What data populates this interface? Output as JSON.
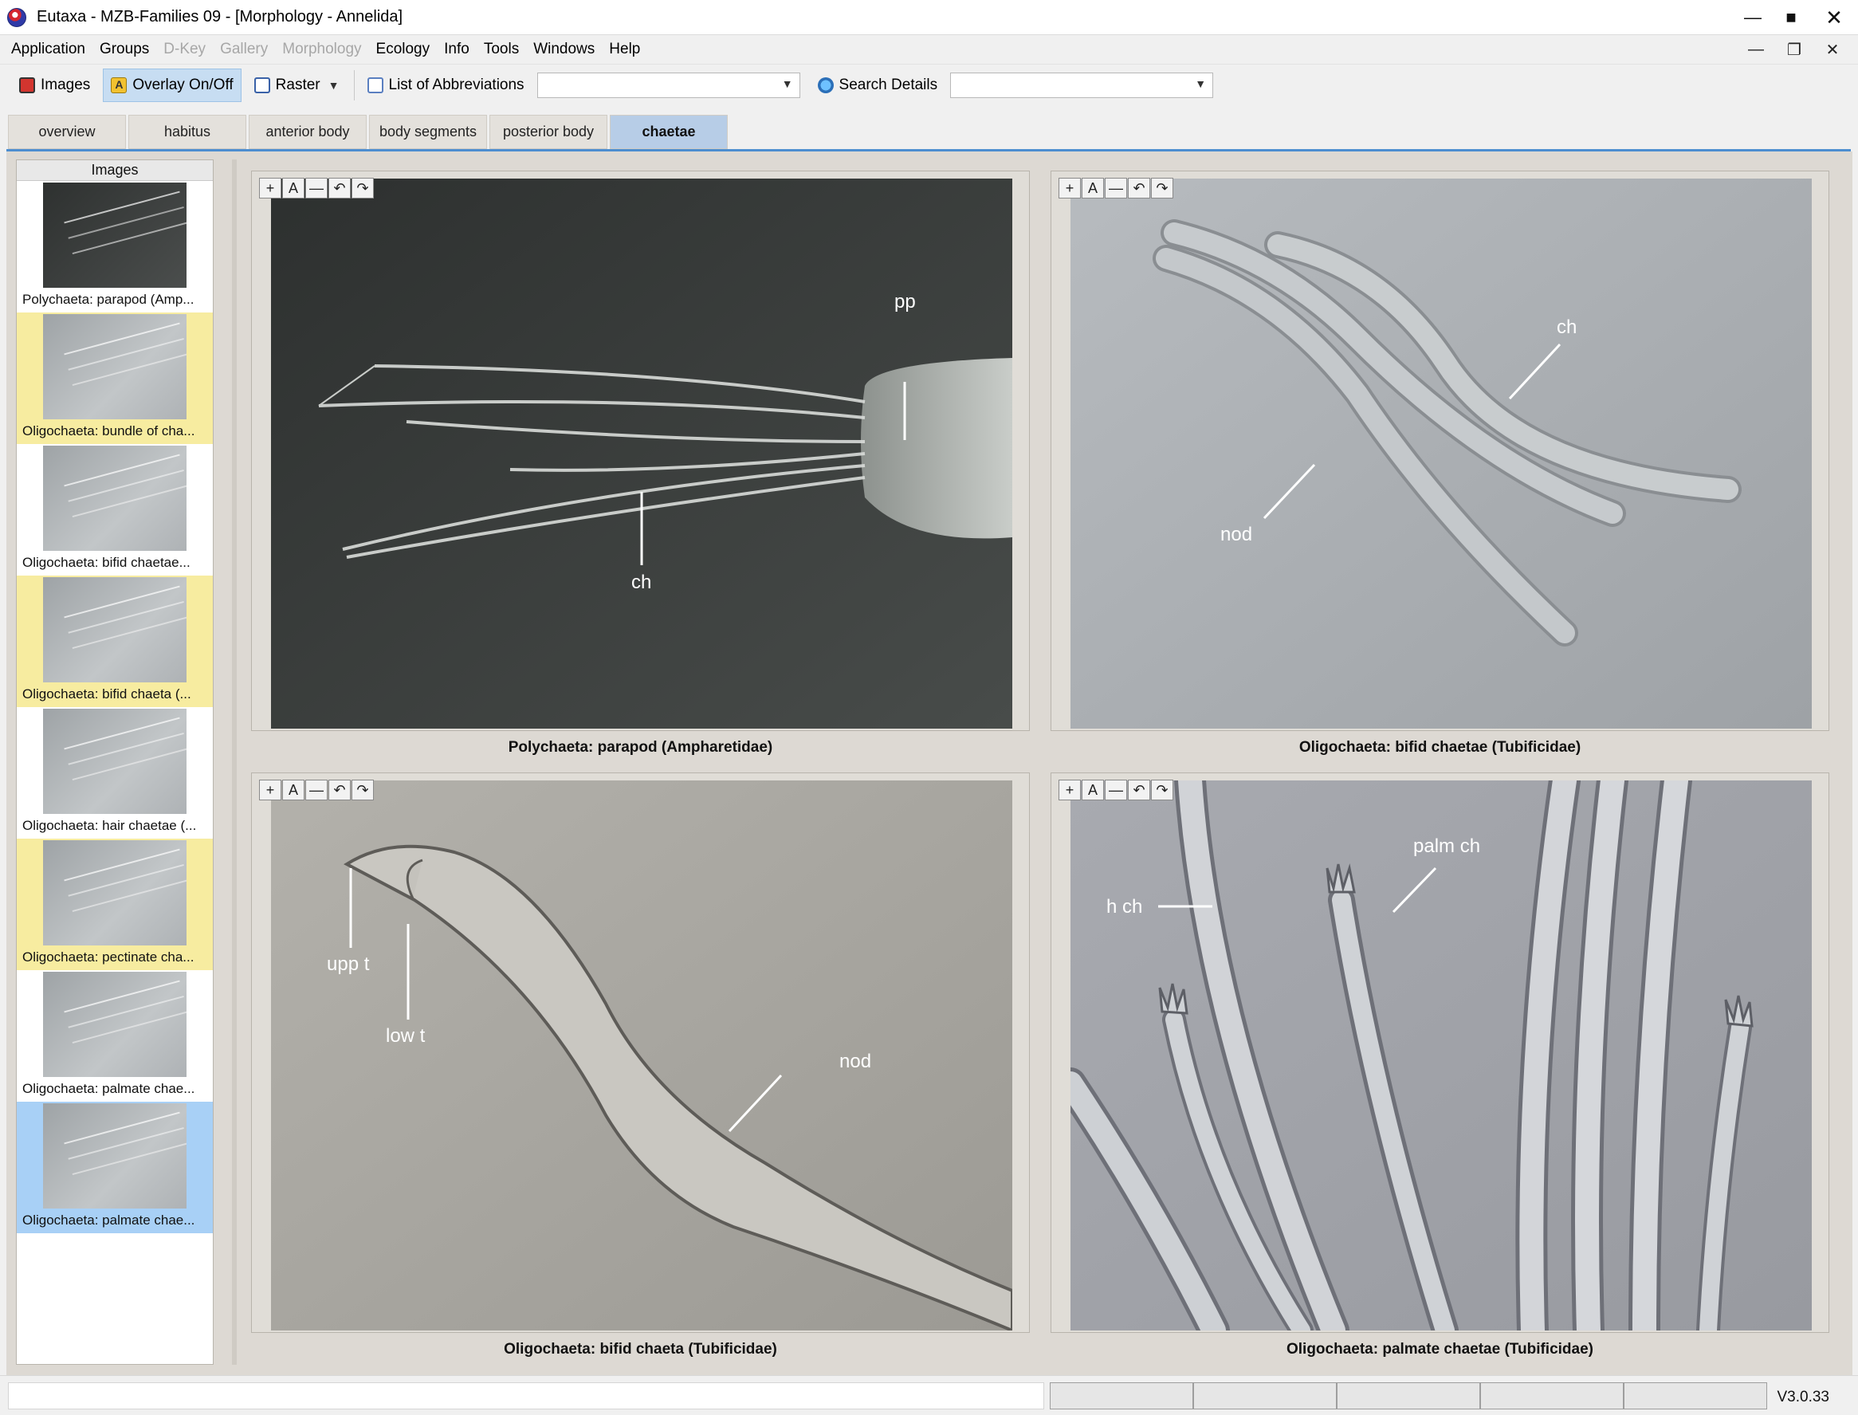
{
  "window": {
    "title": "Eutaxa - MZB-Families 09 - [Morphology - Annelida]",
    "controls": {
      "minimize": "—",
      "maximize": "■",
      "close": "✕"
    }
  },
  "menu": {
    "items": [
      "Application",
      "Groups",
      "D-Key",
      "Gallery",
      "Morphology",
      "Ecology",
      "Info",
      "Tools",
      "Windows",
      "Help"
    ],
    "disabled": [
      "D-Key",
      "Gallery",
      "Morphology"
    ],
    "mdi_controls": {
      "minimize": "—",
      "restore": "❐",
      "close": "✕"
    }
  },
  "toolbar": {
    "images_label": "Images",
    "overlay_label": "Overlay On/Off",
    "raster_label": "Raster",
    "abbreviations_label": "List of Abbreviations",
    "abbreviations_value": "",
    "search_label": "Search Details",
    "search_value": ""
  },
  "tabs": [
    {
      "label": "overview",
      "active": false
    },
    {
      "label": "habitus",
      "active": false
    },
    {
      "label": "anterior body",
      "active": false
    },
    {
      "label": "body segments",
      "active": false
    },
    {
      "label": "posterior body",
      "active": false
    },
    {
      "label": "chaetae",
      "active": true
    }
  ],
  "sidebar": {
    "header": "Images",
    "items": [
      {
        "caption": "Polychaeta: parapod (Amp...",
        "state": "normal",
        "dark": true
      },
      {
        "caption": "Oligochaeta: bundle of cha...",
        "state": "yellow",
        "dark": false
      },
      {
        "caption": "Oligochaeta: bifid chaetae...",
        "state": "normal",
        "dark": false
      },
      {
        "caption": "Oligochaeta: bifid chaeta (...",
        "state": "yellow",
        "dark": false
      },
      {
        "caption": "Oligochaeta: hair chaetae (...",
        "state": "normal",
        "dark": false
      },
      {
        "caption": "Oligochaeta: pectinate cha...",
        "state": "yellow",
        "dark": false
      },
      {
        "caption": "Oligochaeta: palmate chae...",
        "state": "normal",
        "dark": false
      },
      {
        "caption": "Oligochaeta: palmate chae...",
        "state": "selected",
        "dark": false
      }
    ]
  },
  "panel_tools": [
    "+",
    "A",
    "—",
    "↶",
    "↷"
  ],
  "panels": [
    {
      "caption": "Polychaeta: parapod (Ampharetidae)",
      "labels": {
        "a": "pp",
        "b": "ch"
      }
    },
    {
      "caption": "Oligochaeta: bifid chaetae (Tubificidae)",
      "labels": {
        "a": "ch",
        "b": "nod"
      }
    },
    {
      "caption": "Oligochaeta: bifid chaeta (Tubificidae)",
      "labels": {
        "a": "upp t",
        "b": "low t",
        "c": "nod"
      }
    },
    {
      "caption": "Oligochaeta: palmate chaetae (Tubificidae)",
      "labels": {
        "a": "h ch",
        "b": "palm ch"
      }
    }
  ],
  "status": {
    "version": "V3.0.33"
  },
  "colors": {
    "tab_active": "#b7cde7",
    "tab_underline": "#4d8ed0",
    "thumb_highlight": "#f7eca0",
    "thumb_selected": "#a8d0f6"
  }
}
